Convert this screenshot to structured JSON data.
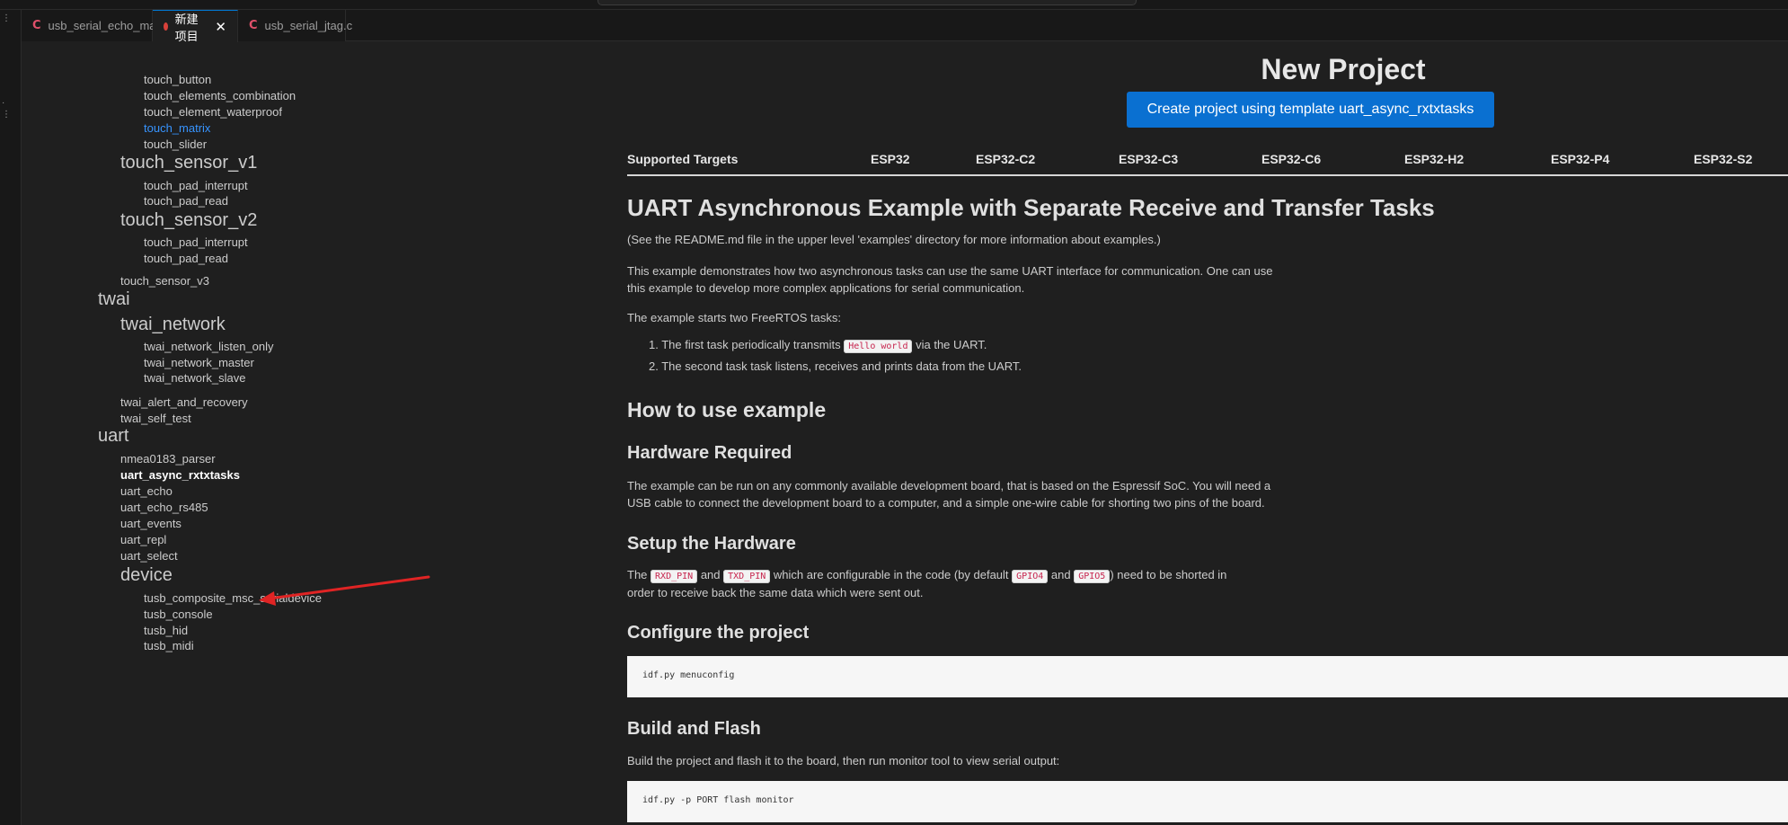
{
  "tabs": [
    {
      "label": "usb_serial_echo_main.c",
      "icon": "c-file-icon"
    },
    {
      "label": "新建项目",
      "icon": "project-dot-icon",
      "active": true
    },
    {
      "label": "usb_serial_jtag.c",
      "icon": "c-file-icon"
    }
  ],
  "activity": {
    "dots_top": "⋮",
    "dots_mid1": "·",
    "dots_mid2": "⋮"
  },
  "tree": {
    "items": [
      {
        "label": "touch_button"
      },
      {
        "label": "touch_elements_combination"
      },
      {
        "label": "touch_element_waterproof"
      },
      {
        "label": "touch_matrix"
      },
      {
        "label": "touch_slider"
      },
      {
        "label": "touch_sensor_v1"
      },
      {
        "label": "touch_pad_interrupt"
      },
      {
        "label": "touch_pad_read"
      },
      {
        "label": "touch_sensor_v2"
      },
      {
        "label": "touch_pad_interrupt"
      },
      {
        "label": "touch_pad_read"
      },
      {
        "label": "touch_sensor_v3"
      },
      {
        "label": "twai"
      },
      {
        "label": "twai_network"
      },
      {
        "label": "twai_network_listen_only"
      },
      {
        "label": "twai_network_master"
      },
      {
        "label": "twai_network_slave"
      },
      {
        "label": "twai_alert_and_recovery"
      },
      {
        "label": "twai_self_test"
      },
      {
        "label": "uart"
      },
      {
        "label": "nmea0183_parser"
      },
      {
        "label": "uart_async_rxtxtasks"
      },
      {
        "label": "uart_echo"
      },
      {
        "label": "uart_echo_rs485"
      },
      {
        "label": "uart_events"
      },
      {
        "label": "uart_repl"
      },
      {
        "label": "uart_select"
      },
      {
        "label": "device"
      },
      {
        "label": "tusb_composite_msc_serialdevice"
      },
      {
        "label": "tusb_console"
      },
      {
        "label": "tusb_hid"
      },
      {
        "label": "tusb_midi"
      }
    ]
  },
  "content": {
    "title": "New Project",
    "create_button": "Create project using template uart_async_rxtxtasks",
    "targets": [
      "Supported Targets",
      "ESP32",
      "ESP32-C2",
      "ESP32-C3",
      "ESP32-C6",
      "ESP32-H2",
      "ESP32-P4",
      "ESP32-S2"
    ],
    "heading": "UART Asynchronous Example with Separate Receive and Transfer Tasks",
    "readme_note": "(See the README.md file in the upper level 'examples' directory for more information about examples.)",
    "intro_line1": "This example demonstrates how two asynchronous tasks can use the same UART interface for communication. One can use",
    "intro_line2": "this example to develop more complex applications for serial communication.",
    "tasks_intro": "The example starts two FreeRTOS tasks:",
    "task1_pre": "1. The first task periodically transmits",
    "task1_code": "Hello world",
    "task1_post": "via the UART.",
    "task2": "2. The second task task listens, receives and prints data from the UART.",
    "how_to": "How to use example",
    "hw_required": "Hardware Required",
    "hw_line1": "The example can be run on any commonly available development board, that is based on the Espressif SoC. You will need a",
    "hw_line2": "USB cable to connect the development board to a computer, and a simple one-wire cable for shorting two pins of the board.",
    "setup_hw": "Setup the Hardware",
    "setup_the": "The",
    "setup_rxd": "RXD_PIN",
    "setup_and1": "and",
    "setup_txd": "TXD_PIN",
    "setup_mid": "which are configurable in the code (by default",
    "setup_gpio4": "GPIO4",
    "setup_and2": "and",
    "setup_gpio5": "GPIO5",
    "setup_end": ") need to be shorted in",
    "setup_line2": "order to receive back the same data which were sent out.",
    "configure": "Configure the project",
    "configure_cmd": "idf.py menuconfig",
    "build_flash": "Build and Flash",
    "build_text": "Build the project and flash it to the board, then run monitor tool to view serial output:",
    "build_cmd": "idf.py -p PORT flash monitor"
  },
  "colors": {
    "accent": "#0a70d1",
    "link": "#3794ff",
    "arrow": "#e02424"
  }
}
